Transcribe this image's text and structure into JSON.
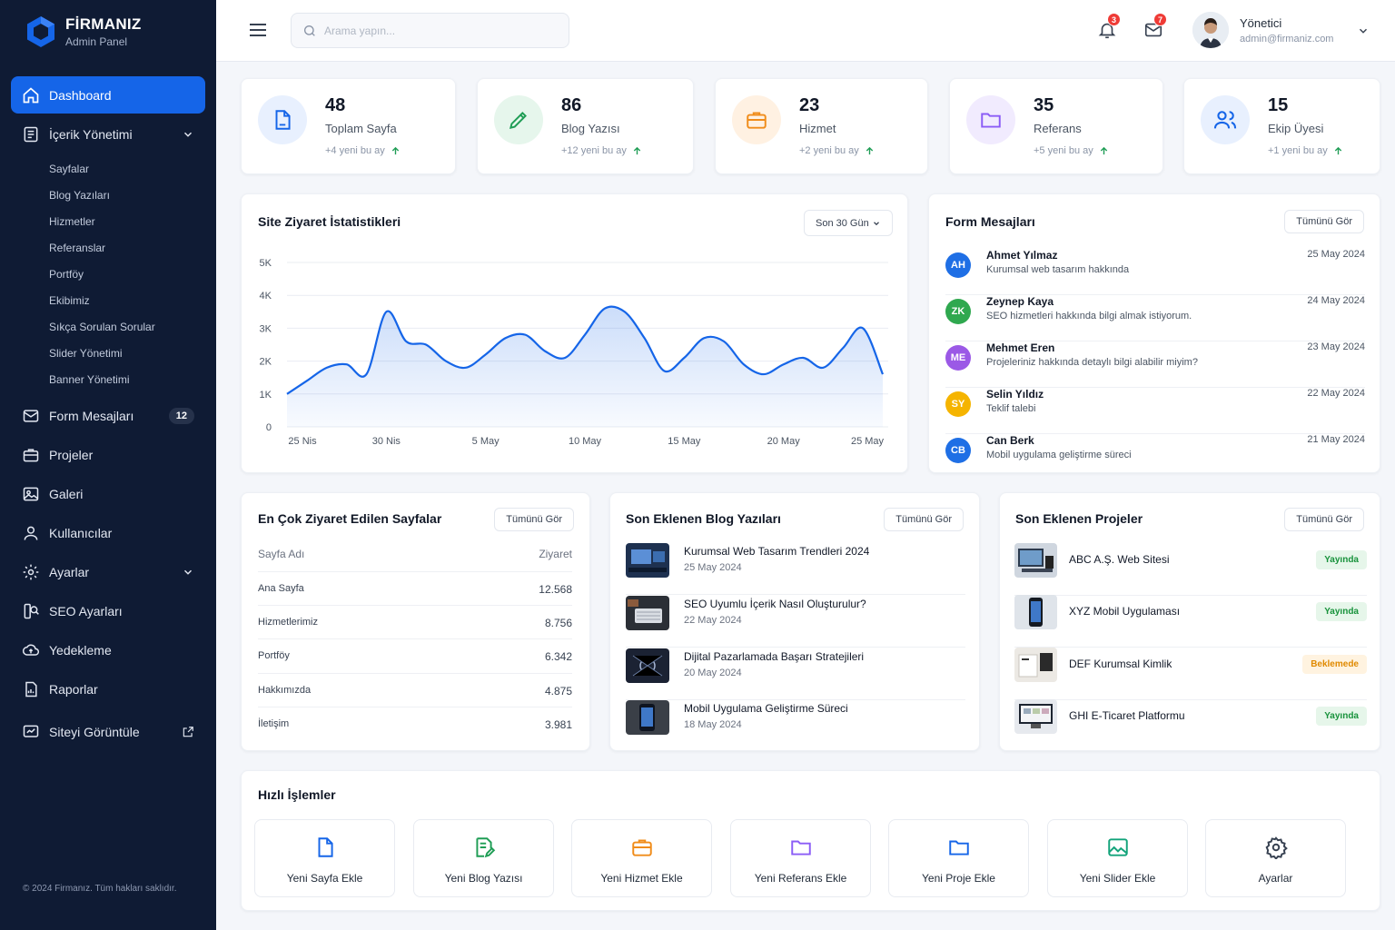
{
  "brand": {
    "name": "FİRMANIZ",
    "subtitle": "Admin Panel"
  },
  "sidebar": {
    "items": [
      {
        "label": "Dashboard",
        "icon": "home-icon",
        "active": true
      },
      {
        "label": "İçerik Yönetimi",
        "icon": "document-icon",
        "expanded": true
      },
      {
        "label": "Form Mesajları",
        "icon": "mail-icon",
        "badge": "12"
      },
      {
        "label": "Projeler",
        "icon": "briefcase-icon"
      },
      {
        "label": "Galeri",
        "icon": "image-icon"
      },
      {
        "label": "Kullanıcılar",
        "icon": "user-icon"
      },
      {
        "label": "Ayarlar",
        "icon": "gear-icon"
      },
      {
        "label": "SEO Ayarları",
        "icon": "seo-icon"
      },
      {
        "label": "Yedekleme",
        "icon": "cloud-icon"
      },
      {
        "label": "Raporlar",
        "icon": "report-icon"
      },
      {
        "label": "Siteyi Görüntüle",
        "icon": "monitor-icon"
      }
    ],
    "sub_items": [
      "Sayfalar",
      "Blog Yazıları",
      "Hizmetler",
      "Referanslar",
      "Portföy",
      "Ekibimiz",
      "Sıkça Sorulan Sorular",
      "Slider Yönetimi",
      "Banner Yönetimi"
    ],
    "copyright": "© 2024 Firmanız. Tüm hakları saklıdır."
  },
  "header": {
    "search_placeholder": "Arama yapın...",
    "notifications_count": "3",
    "messages_count": "7",
    "user_name": "Yönetici",
    "user_email": "admin@firmaniz.com"
  },
  "stats": [
    {
      "value": "48",
      "label": "Toplam Sayfa",
      "trend": "+4 yeni bu ay",
      "color": "#1565e8",
      "bg": "#e8f0fe",
      "icon": "file-icon"
    },
    {
      "value": "86",
      "label": "Blog Yazısı",
      "trend": "+12 yeni bu ay",
      "color": "#1f9d55",
      "bg": "#e6f6ec",
      "icon": "pencil-icon"
    },
    {
      "value": "23",
      "label": "Hizmet",
      "trend": "+2 yeni bu ay",
      "color": "#f08c1a",
      "bg": "#fff1e2",
      "icon": "briefcase-icon"
    },
    {
      "value": "35",
      "label": "Referans",
      "trend": "+5 yeni bu ay",
      "color": "#8b5cf6",
      "bg": "#f1ebfe",
      "icon": "folder-icon"
    },
    {
      "value": "15",
      "label": "Ekip Üyesi",
      "trend": "+1 yeni bu ay",
      "color": "#1565e8",
      "bg": "#e8f0fe",
      "icon": "users-icon"
    }
  ],
  "visits": {
    "title": "Site Ziyaret İstatistikleri",
    "range_select": "Son 30 Gün"
  },
  "chart_data": {
    "type": "area",
    "x": [
      "25 Nis",
      "26 Nis",
      "27 Nis",
      "28 Nis",
      "29 Nis",
      "30 Nis",
      "1 May",
      "2 May",
      "3 May",
      "4 May",
      "5 May",
      "6 May",
      "7 May",
      "8 May",
      "9 May",
      "10 May",
      "11 May",
      "12 May",
      "13 May",
      "14 May",
      "15 May",
      "16 May",
      "17 May",
      "18 May",
      "19 May",
      "20 May",
      "21 May",
      "22 May",
      "23 May",
      "24 May",
      "25 May"
    ],
    "y": [
      1000,
      1400,
      1800,
      1900,
      1600,
      3500,
      2600,
      2500,
      2000,
      1800,
      2200,
      2700,
      2800,
      2300,
      2100,
      2800,
      3600,
      3500,
      2700,
      1700,
      2100,
      2700,
      2600,
      1900,
      1600,
      1900,
      2100,
      1800,
      2400,
      3000,
      1600
    ],
    "xticks": [
      "25 Nis",
      "30 Nis",
      "5 May",
      "10 May",
      "15 May",
      "20 May",
      "25 May"
    ],
    "yticks": [
      "0",
      "1K",
      "2K",
      "3K",
      "4K",
      "5K"
    ],
    "ylim": [
      0,
      5000
    ],
    "grid": true,
    "color": "#1565e8"
  },
  "messages": {
    "title": "Form Mesajları",
    "view_all": "Tümünü Gör",
    "items": [
      {
        "initials": "AH",
        "name": "Ahmet Yılmaz",
        "text": "Kurumsal web tasarım hakkında",
        "date": "25 May 2024",
        "color": "#1f6fe5"
      },
      {
        "initials": "ZK",
        "name": "Zeynep Kaya",
        "text": "SEO hizmetleri hakkında bilgi almak istiyorum.",
        "date": "24 May 2024",
        "color": "#2fa84f"
      },
      {
        "initials": "ME",
        "name": "Mehmet Eren",
        "text": "Projeleriniz hakkında detaylı bilgi alabilir miyim?",
        "date": "23 May 2024",
        "color": "#9b59e6"
      },
      {
        "initials": "SY",
        "name": "Selin Yıldız",
        "text": "Teklif talebi",
        "date": "22 May 2024",
        "color": "#f5b400"
      },
      {
        "initials": "CB",
        "name": "Can Berk",
        "text": "Mobil uygulama geliştirme süreci",
        "date": "21 May 2024",
        "color": "#1f6fe5"
      }
    ]
  },
  "top_pages": {
    "title": "En Çok Ziyaret Edilen Sayfalar",
    "view_all": "Tümünü Gör",
    "col_name": "Sayfa Adı",
    "col_visits": "Ziyaret",
    "rows": [
      {
        "name": "Ana Sayfa",
        "visits": "12.568"
      },
      {
        "name": "Hizmetlerimiz",
        "visits": "8.756"
      },
      {
        "name": "Portföy",
        "visits": "6.342"
      },
      {
        "name": "Hakkımızda",
        "visits": "4.875"
      },
      {
        "name": "İletişim",
        "visits": "3.981"
      }
    ]
  },
  "blog": {
    "title": "Son Eklenen Blog Yazıları",
    "view_all": "Tümünü Gör",
    "items": [
      {
        "title": "Kurumsal Web Tasarım Trendleri 2024",
        "date": "25 May 2024"
      },
      {
        "title": "SEO Uyumlu İçerik Nasıl Oluşturulur?",
        "date": "22 May 2024"
      },
      {
        "title": "Dijital Pazarlamada Başarı Stratejileri",
        "date": "20 May 2024"
      },
      {
        "title": "Mobil Uygulama Geliştirme Süreci",
        "date": "18 May 2024"
      }
    ]
  },
  "projects": {
    "title": "Son Eklenen Projeler",
    "view_all": "Tümünü Gör",
    "items": [
      {
        "name": "ABC A.Ş. Web Sitesi",
        "status": "Yayında",
        "state": "ok"
      },
      {
        "name": "XYZ Mobil Uygulaması",
        "status": "Yayında",
        "state": "ok"
      },
      {
        "name": "DEF Kurumsal Kimlik",
        "status": "Beklemede",
        "state": "wait"
      },
      {
        "name": "GHI E-Ticaret Platformu",
        "status": "Yayında",
        "state": "ok"
      }
    ]
  },
  "quick": {
    "title": "Hızlı İşlemler",
    "items": [
      {
        "label": "Yeni Sayfa Ekle",
        "icon": "file-icon",
        "color": "#1565e8"
      },
      {
        "label": "Yeni Blog Yazısı",
        "icon": "edit-document-icon",
        "color": "#1f9d55"
      },
      {
        "label": "Yeni Hizmet Ekle",
        "icon": "briefcase-icon",
        "color": "#f08c1a"
      },
      {
        "label": "Yeni Referans Ekle",
        "icon": "folder-icon",
        "color": "#8b5cf6"
      },
      {
        "label": "Yeni Proje Ekle",
        "icon": "folder-icon",
        "color": "#1565e8"
      },
      {
        "label": "Yeni Slider Ekle",
        "icon": "image-icon",
        "color": "#12a37a"
      },
      {
        "label": "Ayarlar",
        "icon": "gear-icon",
        "color": "#374151"
      }
    ]
  }
}
